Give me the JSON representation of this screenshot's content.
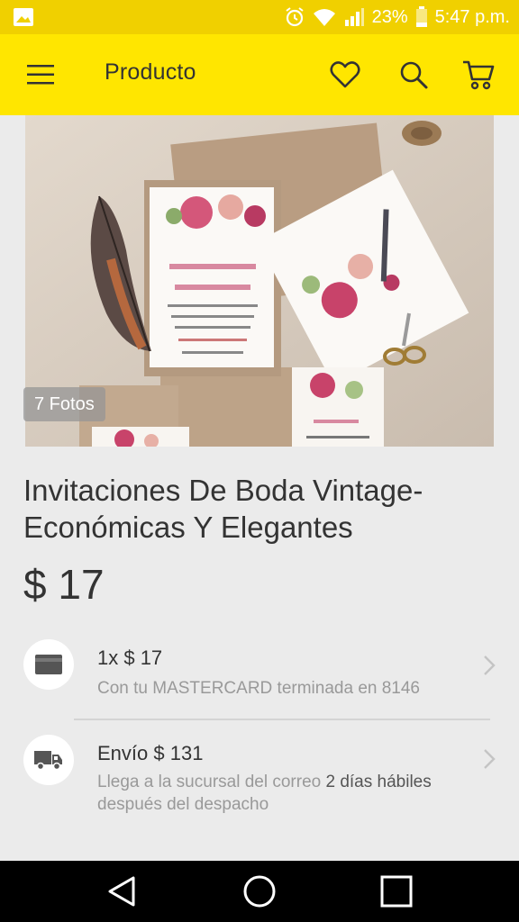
{
  "status_bar": {
    "battery": "23%",
    "time": "5:47 p.m.",
    "icons": [
      "image-notification-icon",
      "alarm-icon",
      "wifi-icon",
      "signal-icon",
      "battery-icon"
    ]
  },
  "app_bar": {
    "title": "Producto",
    "icons": [
      "menu-icon",
      "heart-icon",
      "search-icon",
      "cart-icon"
    ]
  },
  "gallery": {
    "photo_count": "7 Fotos"
  },
  "product": {
    "title": "Invitaciones De Boda Vintage- Económicas Y Elegantes",
    "price": "$ 17"
  },
  "payment": {
    "main": "1x $ 17",
    "sub": "Con tu MASTERCARD terminada en 8146"
  },
  "shipping": {
    "main": "Envío $ 131",
    "sub_prefix": "Llega a la sucursal del correo ",
    "sub_strong": "2 días hábiles",
    "sub_suffix": " después del despacho"
  },
  "colors": {
    "status_bar": "#f0d000",
    "app_bar": "#ffe600",
    "background": "#ebebeb",
    "text": "#333333",
    "muted": "#999999"
  }
}
